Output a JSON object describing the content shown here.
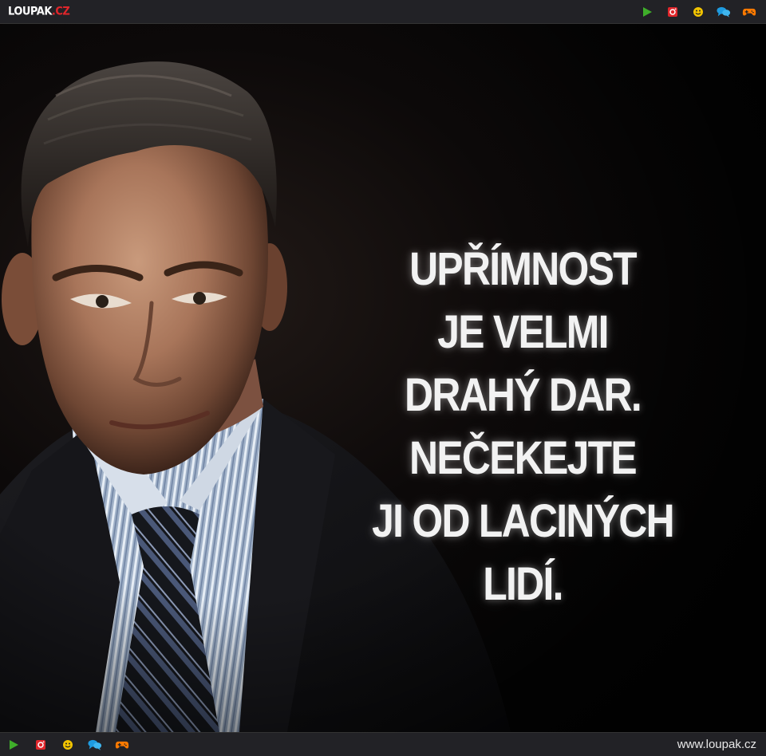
{
  "header": {
    "logo_main": "LOUPAK",
    "logo_tld": ".CZ"
  },
  "toolbar_icons": [
    "play-icon",
    "instagram-icon",
    "smiley-icon",
    "chat-icon",
    "gamepad-icon"
  ],
  "colors": {
    "bar_bg": "#222226",
    "play": "#3fae2a",
    "instagram": "#e0262b",
    "smiley": "#f2c400",
    "chat": "#1e9be0",
    "gamepad": "#ff7a00",
    "logo_accent": "#e0262b"
  },
  "quote": {
    "lines": [
      "UPŘÍMNOST",
      "JE VELMI",
      "DRAHÝ DAR.",
      "NEČEKEJTE",
      "JI OD LACINÝCH",
      "LIDÍ."
    ]
  },
  "footer": {
    "site_url": "www.loupak.cz"
  }
}
